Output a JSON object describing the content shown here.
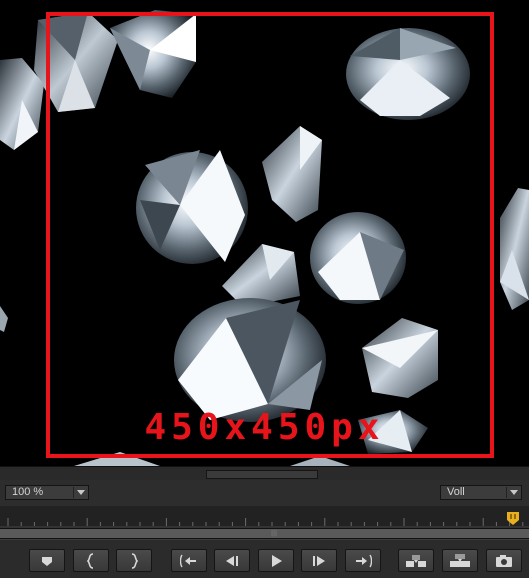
{
  "viewer": {
    "overlay_size_label": "450x450px",
    "frame_color": "#e8141b"
  },
  "controls": {
    "zoom": {
      "value": "100 %"
    },
    "view": {
      "value": "Voll"
    }
  },
  "transport": {
    "buttons": [
      {
        "name": "set-keyframe-button",
        "icon": "keyframe-icon"
      },
      {
        "name": "mark-in-button",
        "icon": "mark-in-brace-icon"
      },
      {
        "name": "mark-out-button",
        "icon": "mark-out-brace-icon"
      },
      {
        "name": "go-to-in-button",
        "icon": "go-to-in-icon"
      },
      {
        "name": "step-back-button",
        "icon": "step-back-icon"
      },
      {
        "name": "play-button",
        "icon": "play-icon"
      },
      {
        "name": "step-forward-button",
        "icon": "step-forward-icon"
      },
      {
        "name": "go-to-out-button",
        "icon": "go-to-out-icon"
      },
      {
        "name": "insert-button",
        "icon": "insert-icon"
      },
      {
        "name": "overwrite-button",
        "icon": "overwrite-icon"
      },
      {
        "name": "export-frame-button",
        "icon": "camera-icon"
      }
    ]
  },
  "colors": {
    "accent_red": "#e8141b",
    "playhead": "#e8b020",
    "panel": "#2d2d2d"
  }
}
